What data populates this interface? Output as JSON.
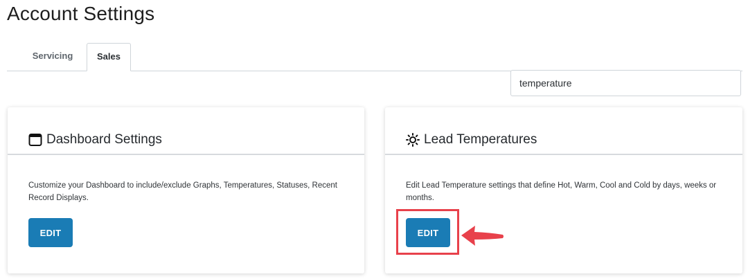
{
  "page": {
    "title": "Account Settings"
  },
  "tabs": [
    {
      "label": "Servicing",
      "active": false
    },
    {
      "label": "Sales",
      "active": true
    }
  ],
  "search": {
    "value": "temperature"
  },
  "cards": [
    {
      "icon": "browser-window-icon",
      "title": "Dashboard Settings",
      "description": "Customize your Dashboard to include/exclude Graphs, Temperatures, Statuses, Recent Record Displays.",
      "button_label": "EDIT"
    },
    {
      "icon": "sun-icon",
      "title": "Lead Temperatures",
      "description": "Edit Lead Temperature settings that define Hot, Warm, Cool and Cold by days, weeks or months.",
      "button_label": "EDIT"
    }
  ],
  "colors": {
    "primary_button": "#1a7cb5",
    "annotation": "#e8414b"
  }
}
